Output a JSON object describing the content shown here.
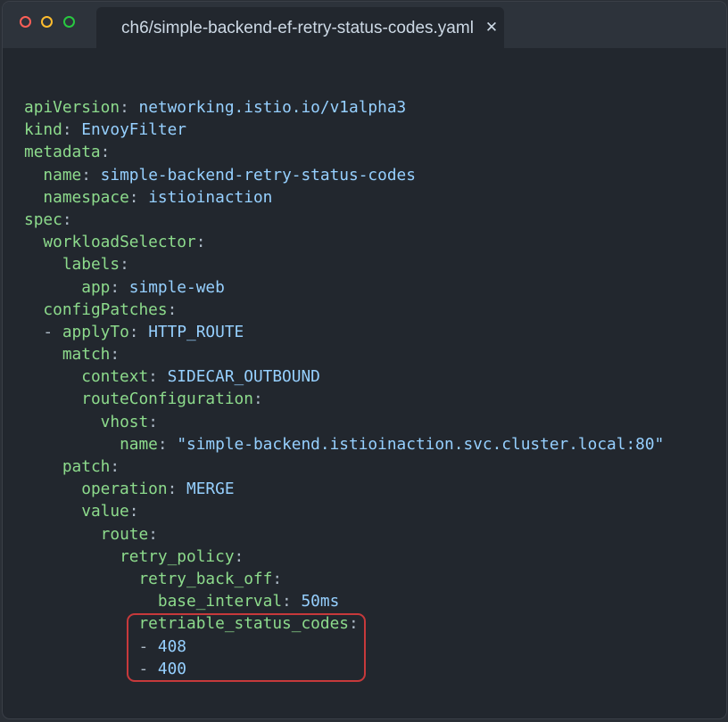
{
  "window": {
    "tab_title": "ch6/simple-backend-ef-retry-status-codes.yaml",
    "close_glyph": "✕"
  },
  "code_lines": [
    {
      "indent": "",
      "dash": "",
      "key": "apiVersion",
      "value": "networking.istio.io/v1alpha3"
    },
    {
      "indent": "",
      "dash": "",
      "key": "kind",
      "value": "EnvoyFilter"
    },
    {
      "indent": "",
      "dash": "",
      "key": "metadata",
      "value": ""
    },
    {
      "indent": "  ",
      "dash": "",
      "key": "name",
      "value": "simple-backend-retry-status-codes"
    },
    {
      "indent": "  ",
      "dash": "",
      "key": "namespace",
      "value": "istioinaction"
    },
    {
      "indent": "",
      "dash": "",
      "key": "spec",
      "value": ""
    },
    {
      "indent": "  ",
      "dash": "",
      "key": "workloadSelector",
      "value": ""
    },
    {
      "indent": "    ",
      "dash": "",
      "key": "labels",
      "value": ""
    },
    {
      "indent": "      ",
      "dash": "",
      "key": "app",
      "value": "simple-web"
    },
    {
      "indent": "  ",
      "dash": "",
      "key": "configPatches",
      "value": ""
    },
    {
      "indent": "  ",
      "dash": "- ",
      "key": "applyTo",
      "value": "HTTP_ROUTE"
    },
    {
      "indent": "    ",
      "dash": "",
      "key": "match",
      "value": ""
    },
    {
      "indent": "      ",
      "dash": "",
      "key": "context",
      "value": "SIDECAR_OUTBOUND"
    },
    {
      "indent": "      ",
      "dash": "",
      "key": "routeConfiguration",
      "value": ""
    },
    {
      "indent": "        ",
      "dash": "",
      "key": "vhost",
      "value": ""
    },
    {
      "indent": "          ",
      "dash": "",
      "key": "name",
      "value": "\"simple-backend.istioinaction.svc.cluster.local:80\""
    },
    {
      "indent": "    ",
      "dash": "",
      "key": "patch",
      "value": ""
    },
    {
      "indent": "      ",
      "dash": "",
      "key": "operation",
      "value": "MERGE"
    },
    {
      "indent": "      ",
      "dash": "",
      "key": "value",
      "value": ""
    },
    {
      "indent": "        ",
      "dash": "",
      "key": "route",
      "value": ""
    },
    {
      "indent": "          ",
      "dash": "",
      "key": "retry_policy",
      "value": ""
    },
    {
      "indent": "            ",
      "dash": "",
      "key": "retry_back_off",
      "value": ""
    },
    {
      "indent": "              ",
      "dash": "",
      "key": "base_interval",
      "value": "50ms"
    },
    {
      "indent": "            ",
      "dash": "",
      "key": "retriable_status_codes",
      "value": ""
    },
    {
      "indent": "            ",
      "dash": "- ",
      "key": "",
      "value": "408"
    },
    {
      "indent": "            ",
      "dash": "- ",
      "key": "",
      "value": "400"
    }
  ],
  "colors": {
    "key": "#8ddb8c",
    "value": "#96d0ff",
    "highlight_border": "#c7393b"
  }
}
